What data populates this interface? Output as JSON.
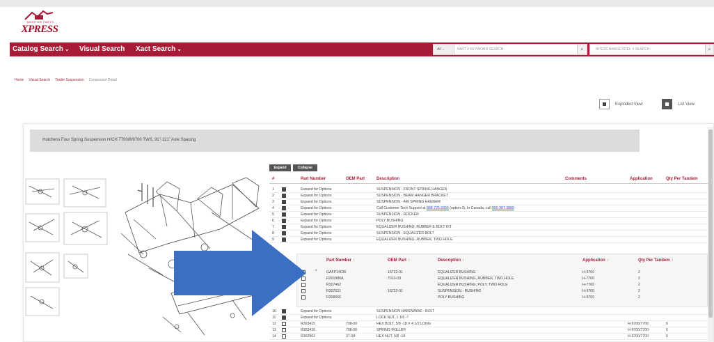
{
  "logo": {
    "small": "MERITOR PARTS",
    "brand": "XPRESS"
  },
  "nav": {
    "catalog_search": "Catalog Search",
    "visual_search": "Visual Search",
    "xact_search": "Xact Search",
    "search_scope": "All",
    "search_placeholder": "PART # KEYWORD SEARCH",
    "interchange_placeholder": "INTERCHANGE/XREF # SEARCH"
  },
  "breadcrumb": [
    "Home",
    "Visual Search",
    "Trailer Suspension",
    "Component Detail"
  ],
  "views": {
    "exploded": "Exploded View",
    "list": "List View"
  },
  "title": "Hutchens Four Spring Suspension H/CH 7700/8/9700 TWS, 91\"-121\" Axle Spacing",
  "table": {
    "expand_btn": "Expand",
    "collapse_btn": "Collapse",
    "headers": {
      "num": "#",
      "part": "Part Number",
      "oem": "OEM Part",
      "desc": "Description",
      "comments": "Comments",
      "application": "Application",
      "qty": "Qty Per Tandem"
    },
    "rows": [
      {
        "num": "1",
        "part": "Expand for Options",
        "oem": "",
        "desc": "SUSPENSION - FRONT SPRING HANGER"
      },
      {
        "num": "2",
        "part": "Expand for Options",
        "oem": "",
        "desc": "SUSPENSION - BEAM HANGER BRACKET"
      },
      {
        "num": "3",
        "part": "Expand for Options",
        "oem": "",
        "desc": "SUSPENSION - AIR SPRING HANGER"
      },
      {
        "num": "4",
        "part": "Expand for Options",
        "oem": "",
        "desc": "Call Customer Tech Support at",
        "link1": "888.725.9355",
        "desc_mid": "(option 3). In Canada, call",
        "link2": "800.387.3889"
      },
      {
        "num": "5",
        "part": "Expand for Options",
        "oem": "",
        "desc": "SUSPENSION - ROCKER"
      },
      {
        "num": "6",
        "part": "Expand for Options",
        "oem": "",
        "desc": "POLY BUSHING"
      },
      {
        "num": "7",
        "part": "Expand for Options",
        "oem": "",
        "desc": "EQUALIZER BUSHING, RUBBER & BOLT KIT"
      },
      {
        "num": "8",
        "part": "Expand for Options",
        "oem": "",
        "desc": "SUSPENSION - EQUALIZER BOLT"
      },
      {
        "num": "9",
        "part": "Expand for Options",
        "oem": "",
        "desc": "EQUALIZER BUSHING, RUBBER, TWO HOLE"
      }
    ],
    "sub_headers": {
      "part": "Part Number",
      "oem": "OEM Part",
      "desc": "Description",
      "application": "Application",
      "qty": "Qty Per Tandem",
      "sort": "↕"
    },
    "sub_rows": [
      {
        "mark": "*",
        "part": "GAFP14036",
        "oem": "16723-01",
        "desc": "EQUALIZER BUSHING",
        "app": "H-9700",
        "qty": "2"
      },
      {
        "mark": "",
        "part": "R301986A",
        "oem": "7010-00",
        "desc": "EQUALIZER BUSHING, RUBBER, TWO HOLE",
        "app": "H-7700",
        "qty": "2"
      },
      {
        "mark": "",
        "part": "R307462",
        "oem": "",
        "desc": "EQUALIZER BUSHING, POLY, TWO HOLE",
        "app": "H-7700",
        "qty": "2"
      },
      {
        "mark": "",
        "part": "R307621",
        "oem": "16723-01",
        "desc": "SUSPENSION - BUSHING",
        "app": "H-9700",
        "qty": "2"
      },
      {
        "mark": "",
        "part": "R308666",
        "oem": "",
        "desc": "POLY BUSHING",
        "app": "H-9700",
        "qty": "2"
      }
    ],
    "rows_after": [
      {
        "num": "10",
        "part": "Expand for Options",
        "oem": "",
        "desc": "SUSPENSION HARDWARE - BOLT",
        "app": "",
        "qty": ""
      },
      {
        "num": "11",
        "part": "Expand for Options",
        "oem": "",
        "desc": "LOCK NUT, 1 1/8 -7",
        "app": "",
        "qty": ""
      },
      {
        "num": "12",
        "part": "R303415",
        "oem": "798-00",
        "desc": "HEX BOLT, 5/8 -18 X 4 1/2 LONG",
        "app": "H-9700/7700",
        "qty": "6"
      },
      {
        "num": "13",
        "part": "R303416",
        "oem": "798-00",
        "desc": "SPRING ROLLER",
        "app": "H-9700/7700",
        "qty": "6"
      },
      {
        "num": "14",
        "part": "R302502",
        "oem": "37-00",
        "desc": "HEX NUT, 5/8 -18",
        "app": "H-9700/7700",
        "qty": "6"
      }
    ]
  },
  "colors": {
    "brand": "#a61c36",
    "arrow": "#3a6fc2",
    "link": "#1a55c8"
  }
}
